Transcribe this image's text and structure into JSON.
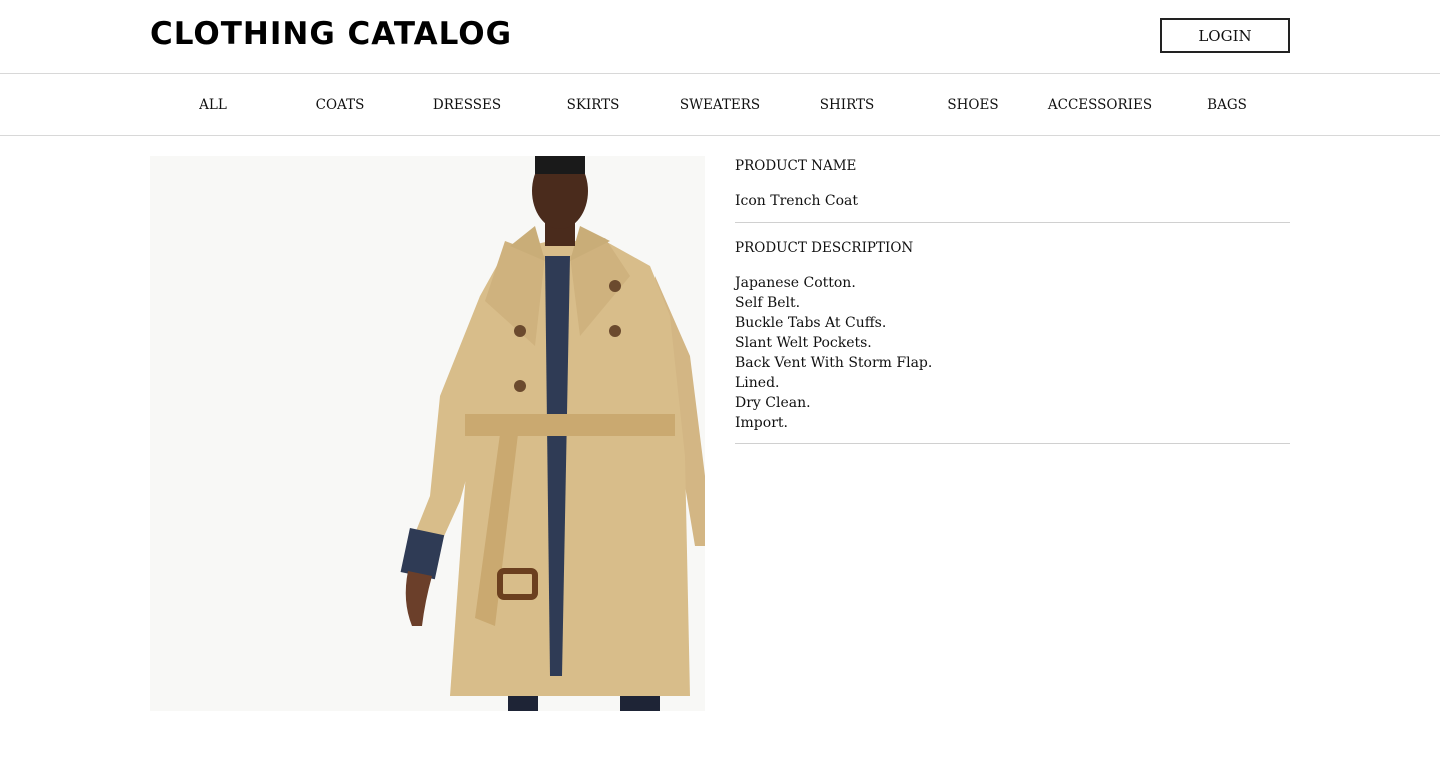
{
  "header": {
    "logo": "CLOTHING CATALOG",
    "login_label": "LOGIN"
  },
  "nav": {
    "items": [
      "ALL",
      "COATS",
      "DRESSES",
      "SKIRTS",
      "SWEATERS",
      "SHIRTS",
      "SHOES",
      "ACCESSORIES",
      "BAGS"
    ]
  },
  "product": {
    "name_label": "PRODUCT NAME",
    "name": "Icon Trench Coat",
    "description_label": "PRODUCT DESCRIPTION",
    "description": [
      "Japanese Cotton.",
      "Self Belt.",
      "Buckle Tabs At Cuffs.",
      "Slant Welt Pockets.",
      "Back Vent With Storm Flap.",
      "Lined.",
      "Dry Clean.",
      "Import."
    ],
    "image": {
      "coat_color": "#d8bd8a",
      "shirt_color": "#2f3b55",
      "background": "#f8f8f6"
    }
  }
}
